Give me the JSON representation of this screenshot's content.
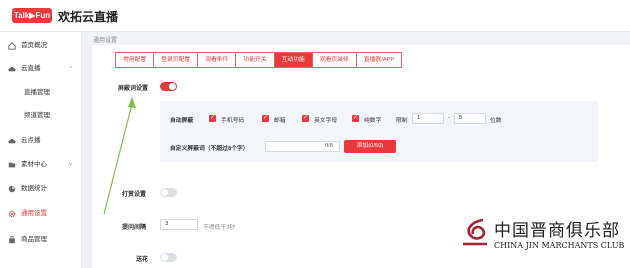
{
  "app": {
    "logo": "Talk▶Fun",
    "title": "欢拓云直播"
  },
  "sidebar": {
    "items": [
      {
        "label": "首页概况",
        "icon": "home-icon"
      },
      {
        "label": "云直播",
        "icon": "cloud-icon",
        "chevron": "^"
      },
      {
        "label": "直播管理",
        "sub": true
      },
      {
        "label": "频道管理",
        "sub": true
      },
      {
        "label": "云点播",
        "icon": "cloud-icon"
      },
      {
        "label": "素材中心",
        "icon": "folder-icon",
        "chevron": "v"
      },
      {
        "label": "数据统计",
        "icon": "chart-icon"
      },
      {
        "label": "通用设置",
        "icon": "gear-icon",
        "active": true
      },
      {
        "label": "商品管理",
        "icon": "bag-icon"
      }
    ]
  },
  "breadcrumb": "通用设置",
  "tabs": [
    {
      "label": "常用配置"
    },
    {
      "label": "登录页配置"
    },
    {
      "label": "观看条件"
    },
    {
      "label": "功能开关"
    },
    {
      "label": "互动功能",
      "active": true
    },
    {
      "label": "观看页装修"
    },
    {
      "label": "直播器/APP"
    }
  ],
  "settings": {
    "shield_label": "屏蔽词设置",
    "shield_on": true,
    "auto_shield_label": "自动屏蔽",
    "options": [
      "手机号码",
      "邮箱",
      "英文字母",
      "纯数字"
    ],
    "limit_label": "限制",
    "limit_min": "1",
    "dash": "-",
    "limit_max": "5",
    "digits_label": "位数",
    "custom_label": "自定义屏蔽词（不超过8个字）",
    "custom_count": "0/8",
    "add_button": "添加(0/50)",
    "reward_label": "打赏设置",
    "reward_on": false,
    "interval_label": "提问间隔",
    "interval_value": "3",
    "interval_hint": "不得低于3秒",
    "flower_label": "送花",
    "flower_on": false
  },
  "watermark": {
    "cn": "中国晋商俱乐部",
    "en": "CHINA JIN MARCHANTS CLUB"
  },
  "colors": {
    "accent": "#e83a3a",
    "arrow": "#7cc242"
  }
}
